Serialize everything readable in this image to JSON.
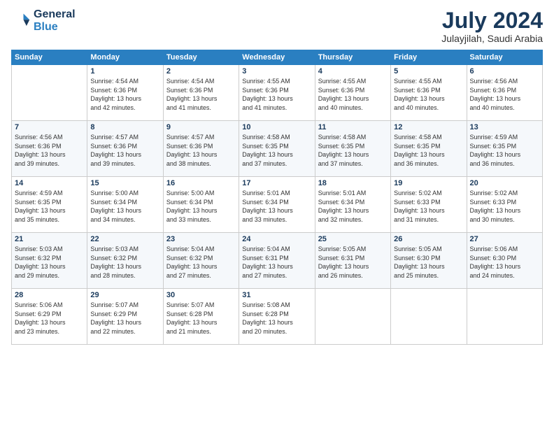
{
  "logo": {
    "line1": "General",
    "line2": "Blue"
  },
  "title": "July 2024",
  "location": "Julayjilah, Saudi Arabia",
  "days_header": [
    "Sunday",
    "Monday",
    "Tuesday",
    "Wednesday",
    "Thursday",
    "Friday",
    "Saturday"
  ],
  "weeks": [
    [
      {
        "day": "",
        "info": ""
      },
      {
        "day": "1",
        "info": "Sunrise: 4:54 AM\nSunset: 6:36 PM\nDaylight: 13 hours\nand 42 minutes."
      },
      {
        "day": "2",
        "info": "Sunrise: 4:54 AM\nSunset: 6:36 PM\nDaylight: 13 hours\nand 41 minutes."
      },
      {
        "day": "3",
        "info": "Sunrise: 4:55 AM\nSunset: 6:36 PM\nDaylight: 13 hours\nand 41 minutes."
      },
      {
        "day": "4",
        "info": "Sunrise: 4:55 AM\nSunset: 6:36 PM\nDaylight: 13 hours\nand 40 minutes."
      },
      {
        "day": "5",
        "info": "Sunrise: 4:55 AM\nSunset: 6:36 PM\nDaylight: 13 hours\nand 40 minutes."
      },
      {
        "day": "6",
        "info": "Sunrise: 4:56 AM\nSunset: 6:36 PM\nDaylight: 13 hours\nand 40 minutes."
      }
    ],
    [
      {
        "day": "7",
        "info": "Sunrise: 4:56 AM\nSunset: 6:36 PM\nDaylight: 13 hours\nand 39 minutes."
      },
      {
        "day": "8",
        "info": "Sunrise: 4:57 AM\nSunset: 6:36 PM\nDaylight: 13 hours\nand 39 minutes."
      },
      {
        "day": "9",
        "info": "Sunrise: 4:57 AM\nSunset: 6:36 PM\nDaylight: 13 hours\nand 38 minutes."
      },
      {
        "day": "10",
        "info": "Sunrise: 4:58 AM\nSunset: 6:35 PM\nDaylight: 13 hours\nand 37 minutes."
      },
      {
        "day": "11",
        "info": "Sunrise: 4:58 AM\nSunset: 6:35 PM\nDaylight: 13 hours\nand 37 minutes."
      },
      {
        "day": "12",
        "info": "Sunrise: 4:58 AM\nSunset: 6:35 PM\nDaylight: 13 hours\nand 36 minutes."
      },
      {
        "day": "13",
        "info": "Sunrise: 4:59 AM\nSunset: 6:35 PM\nDaylight: 13 hours\nand 36 minutes."
      }
    ],
    [
      {
        "day": "14",
        "info": "Sunrise: 4:59 AM\nSunset: 6:35 PM\nDaylight: 13 hours\nand 35 minutes."
      },
      {
        "day": "15",
        "info": "Sunrise: 5:00 AM\nSunset: 6:34 PM\nDaylight: 13 hours\nand 34 minutes."
      },
      {
        "day": "16",
        "info": "Sunrise: 5:00 AM\nSunset: 6:34 PM\nDaylight: 13 hours\nand 33 minutes."
      },
      {
        "day": "17",
        "info": "Sunrise: 5:01 AM\nSunset: 6:34 PM\nDaylight: 13 hours\nand 33 minutes."
      },
      {
        "day": "18",
        "info": "Sunrise: 5:01 AM\nSunset: 6:34 PM\nDaylight: 13 hours\nand 32 minutes."
      },
      {
        "day": "19",
        "info": "Sunrise: 5:02 AM\nSunset: 6:33 PM\nDaylight: 13 hours\nand 31 minutes."
      },
      {
        "day": "20",
        "info": "Sunrise: 5:02 AM\nSunset: 6:33 PM\nDaylight: 13 hours\nand 30 minutes."
      }
    ],
    [
      {
        "day": "21",
        "info": "Sunrise: 5:03 AM\nSunset: 6:32 PM\nDaylight: 13 hours\nand 29 minutes."
      },
      {
        "day": "22",
        "info": "Sunrise: 5:03 AM\nSunset: 6:32 PM\nDaylight: 13 hours\nand 28 minutes."
      },
      {
        "day": "23",
        "info": "Sunrise: 5:04 AM\nSunset: 6:32 PM\nDaylight: 13 hours\nand 27 minutes."
      },
      {
        "day": "24",
        "info": "Sunrise: 5:04 AM\nSunset: 6:31 PM\nDaylight: 13 hours\nand 27 minutes."
      },
      {
        "day": "25",
        "info": "Sunrise: 5:05 AM\nSunset: 6:31 PM\nDaylight: 13 hours\nand 26 minutes."
      },
      {
        "day": "26",
        "info": "Sunrise: 5:05 AM\nSunset: 6:30 PM\nDaylight: 13 hours\nand 25 minutes."
      },
      {
        "day": "27",
        "info": "Sunrise: 5:06 AM\nSunset: 6:30 PM\nDaylight: 13 hours\nand 24 minutes."
      }
    ],
    [
      {
        "day": "28",
        "info": "Sunrise: 5:06 AM\nSunset: 6:29 PM\nDaylight: 13 hours\nand 23 minutes."
      },
      {
        "day": "29",
        "info": "Sunrise: 5:07 AM\nSunset: 6:29 PM\nDaylight: 13 hours\nand 22 minutes."
      },
      {
        "day": "30",
        "info": "Sunrise: 5:07 AM\nSunset: 6:28 PM\nDaylight: 13 hours\nand 21 minutes."
      },
      {
        "day": "31",
        "info": "Sunrise: 5:08 AM\nSunset: 6:28 PM\nDaylight: 13 hours\nand 20 minutes."
      },
      {
        "day": "",
        "info": ""
      },
      {
        "day": "",
        "info": ""
      },
      {
        "day": "",
        "info": ""
      }
    ]
  ]
}
